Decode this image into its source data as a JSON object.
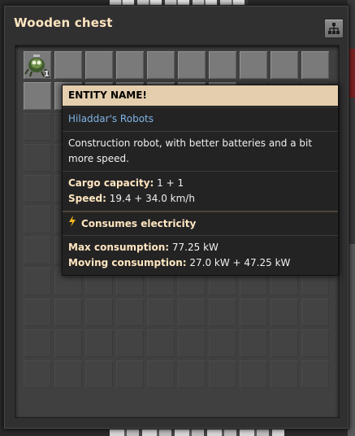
{
  "window": {
    "title": "Wooden chest",
    "header_button_icon": "logistic-network-icon"
  },
  "inventory": {
    "slot_item": {
      "icon": "construction-robot-icon",
      "count": "1"
    }
  },
  "tooltip": {
    "header": "ENTITY NAME!",
    "mod_name": "Hiladdar's Robots",
    "description": "Construction robot, with better batteries and a bit more speed.",
    "cargo_label": "Cargo capacity:",
    "cargo_value": "1 + 1",
    "speed_label": "Speed:",
    "speed_value": "19.4 + 34.0  km/h",
    "energy_icon": "lightning-icon",
    "energy_title": "Consumes electricity",
    "max_label": "Max consumption:",
    "max_value": "77.25 kW",
    "moving_label": "Moving consumption:",
    "moving_value": "27.0 kW + 47.25 kW"
  },
  "colors": {
    "header_bg": "#e4cead",
    "title_text": "#ffe6c0",
    "mod_text": "#7fb3e4",
    "bolt": "#f3b81c"
  }
}
